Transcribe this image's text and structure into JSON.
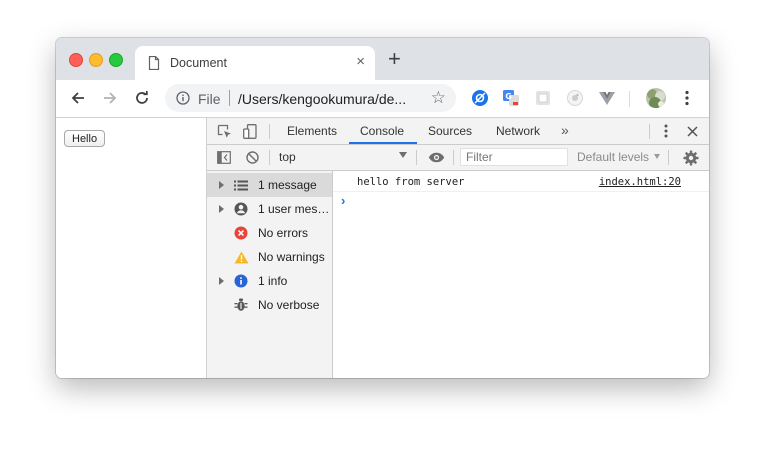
{
  "window": {
    "traffic_lights": {
      "close": "#fe5f57",
      "minimize": "#febb2e",
      "zoom": "#28c840"
    }
  },
  "tab": {
    "title": "Document",
    "close_glyph": "×",
    "new_tab_glyph": "+"
  },
  "toolbar": {
    "omnibox": {
      "scheme_label": "File",
      "url": "/Users/kengookumura/de..."
    },
    "icons": [
      "back-arrow-icon",
      "forward-arrow-icon",
      "reload-icon",
      "info-icon",
      "star-icon",
      "kebab-menu-icon"
    ],
    "extensions": [
      "blue-compass-extension",
      "translate-extension",
      "grey-square-extension",
      "camera-extension",
      "vue-devtools-extension"
    ]
  },
  "page": {
    "hello_button_label": "Hello"
  },
  "devtools": {
    "tabs": [
      "Elements",
      "Console",
      "Sources",
      "Network"
    ],
    "active_tab": "Console",
    "more_tabs_glyph": "»",
    "accent_color": "#1a73e8",
    "console_toolbar": {
      "context": "top",
      "filter_placeholder": "Filter",
      "levels_label": "Default levels"
    },
    "sidebar": [
      {
        "label": "1 message",
        "icon": "list-icon",
        "expandable": true,
        "selected": true
      },
      {
        "label": "1 user mes…",
        "icon": "user-icon",
        "expandable": true,
        "selected": false
      },
      {
        "label": "No errors",
        "icon": "error-icon",
        "expandable": false,
        "selected": false
      },
      {
        "label": "No warnings",
        "icon": "warning-icon",
        "expandable": false,
        "selected": false
      },
      {
        "label": "1 info",
        "icon": "info-icon",
        "expandable": true,
        "selected": false
      },
      {
        "label": "No verbose",
        "icon": "bug-icon",
        "expandable": false,
        "selected": false
      }
    ],
    "log": [
      {
        "message": "hello from server",
        "source": "index.html:20"
      }
    ],
    "prompt_glyph": "›"
  }
}
